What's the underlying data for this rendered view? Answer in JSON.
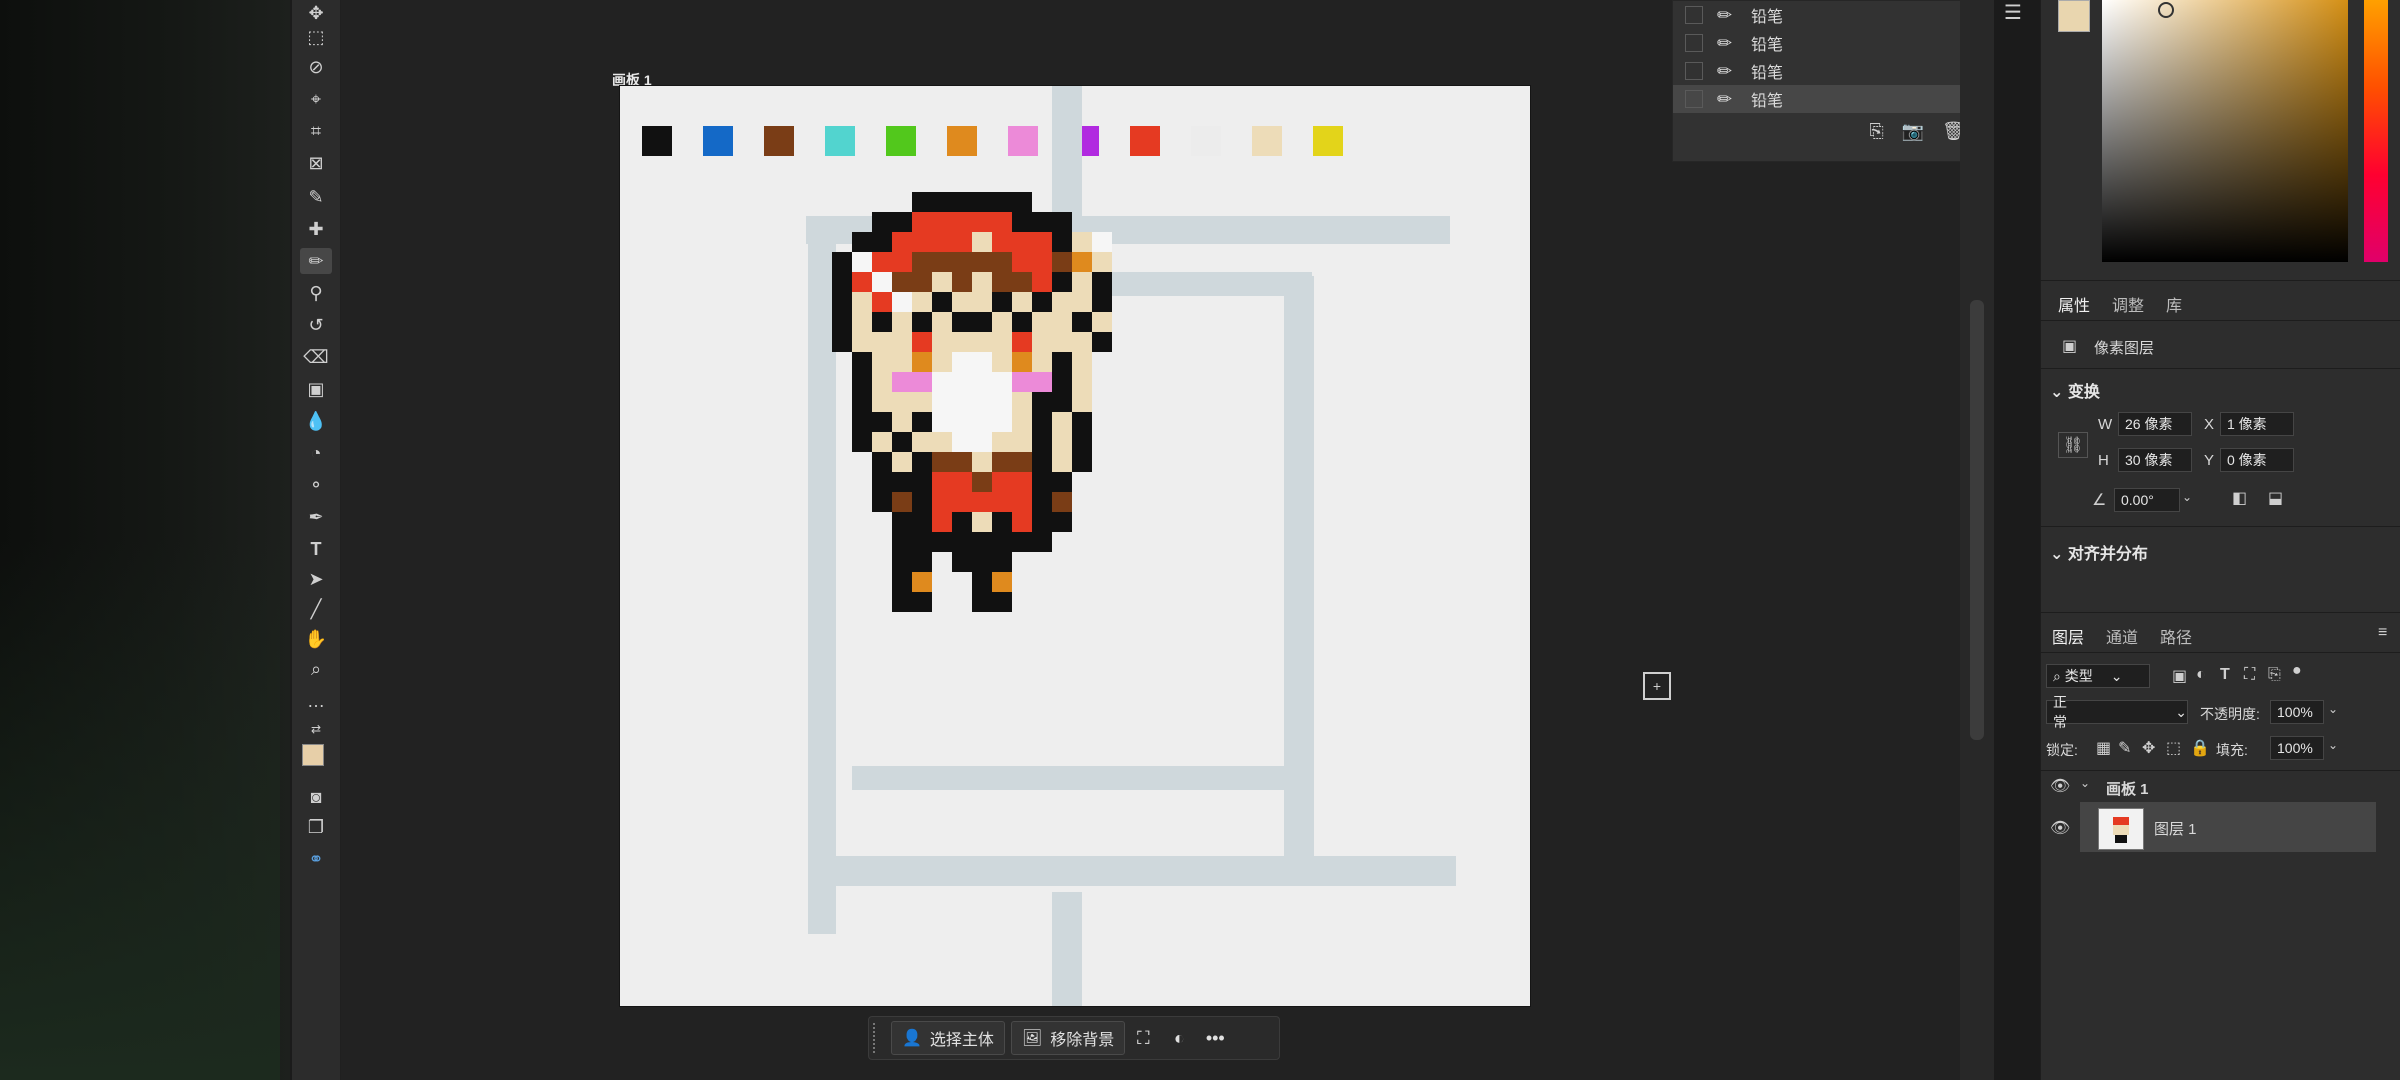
{
  "artboard": {
    "label": "画板 1",
    "swatches": [
      "#111111",
      "#1469c7",
      "#7a3d16",
      "#52d4cf",
      "#52c81c",
      "#df8a1e",
      "#ec8ad8",
      "#b12ae0",
      "#e53a22",
      "#ececec",
      "#eddcb8",
      "#e3d41a"
    ]
  },
  "context_bar": {
    "select_subject": "选择主体",
    "remove_background": "移除背景",
    "more": "•••"
  },
  "history": {
    "items": [
      "铅笔",
      "铅笔",
      "铅笔",
      "铅笔"
    ]
  },
  "properties": {
    "tabs": [
      "属性",
      "调整",
      "库"
    ],
    "layer_type": "像素图层",
    "transform_title": "变换",
    "w_label": "W",
    "w_value": "26 像素",
    "h_label": "H",
    "h_value": "30 像素",
    "x_label": "X",
    "x_value": "1 像素",
    "y_label": "Y",
    "y_value": "0 像素",
    "angle_value": "0.00°",
    "align_title": "对齐并分布"
  },
  "layers": {
    "tabs": [
      "图层",
      "通道",
      "路径"
    ],
    "filter_kind": "类型",
    "blend_mode": "正常",
    "opacity_label": "不透明度:",
    "opacity_value": "100%",
    "lock_label": "锁定:",
    "fill_label": "填充:",
    "fill_value": "100%",
    "artboard_name": "画板 1",
    "layer_name": "图层 1"
  },
  "colors": {
    "workspace": "#222222",
    "panel": "#2d2d2d",
    "artboard": "#eeeeee",
    "guide": "#cfd8dc"
  }
}
